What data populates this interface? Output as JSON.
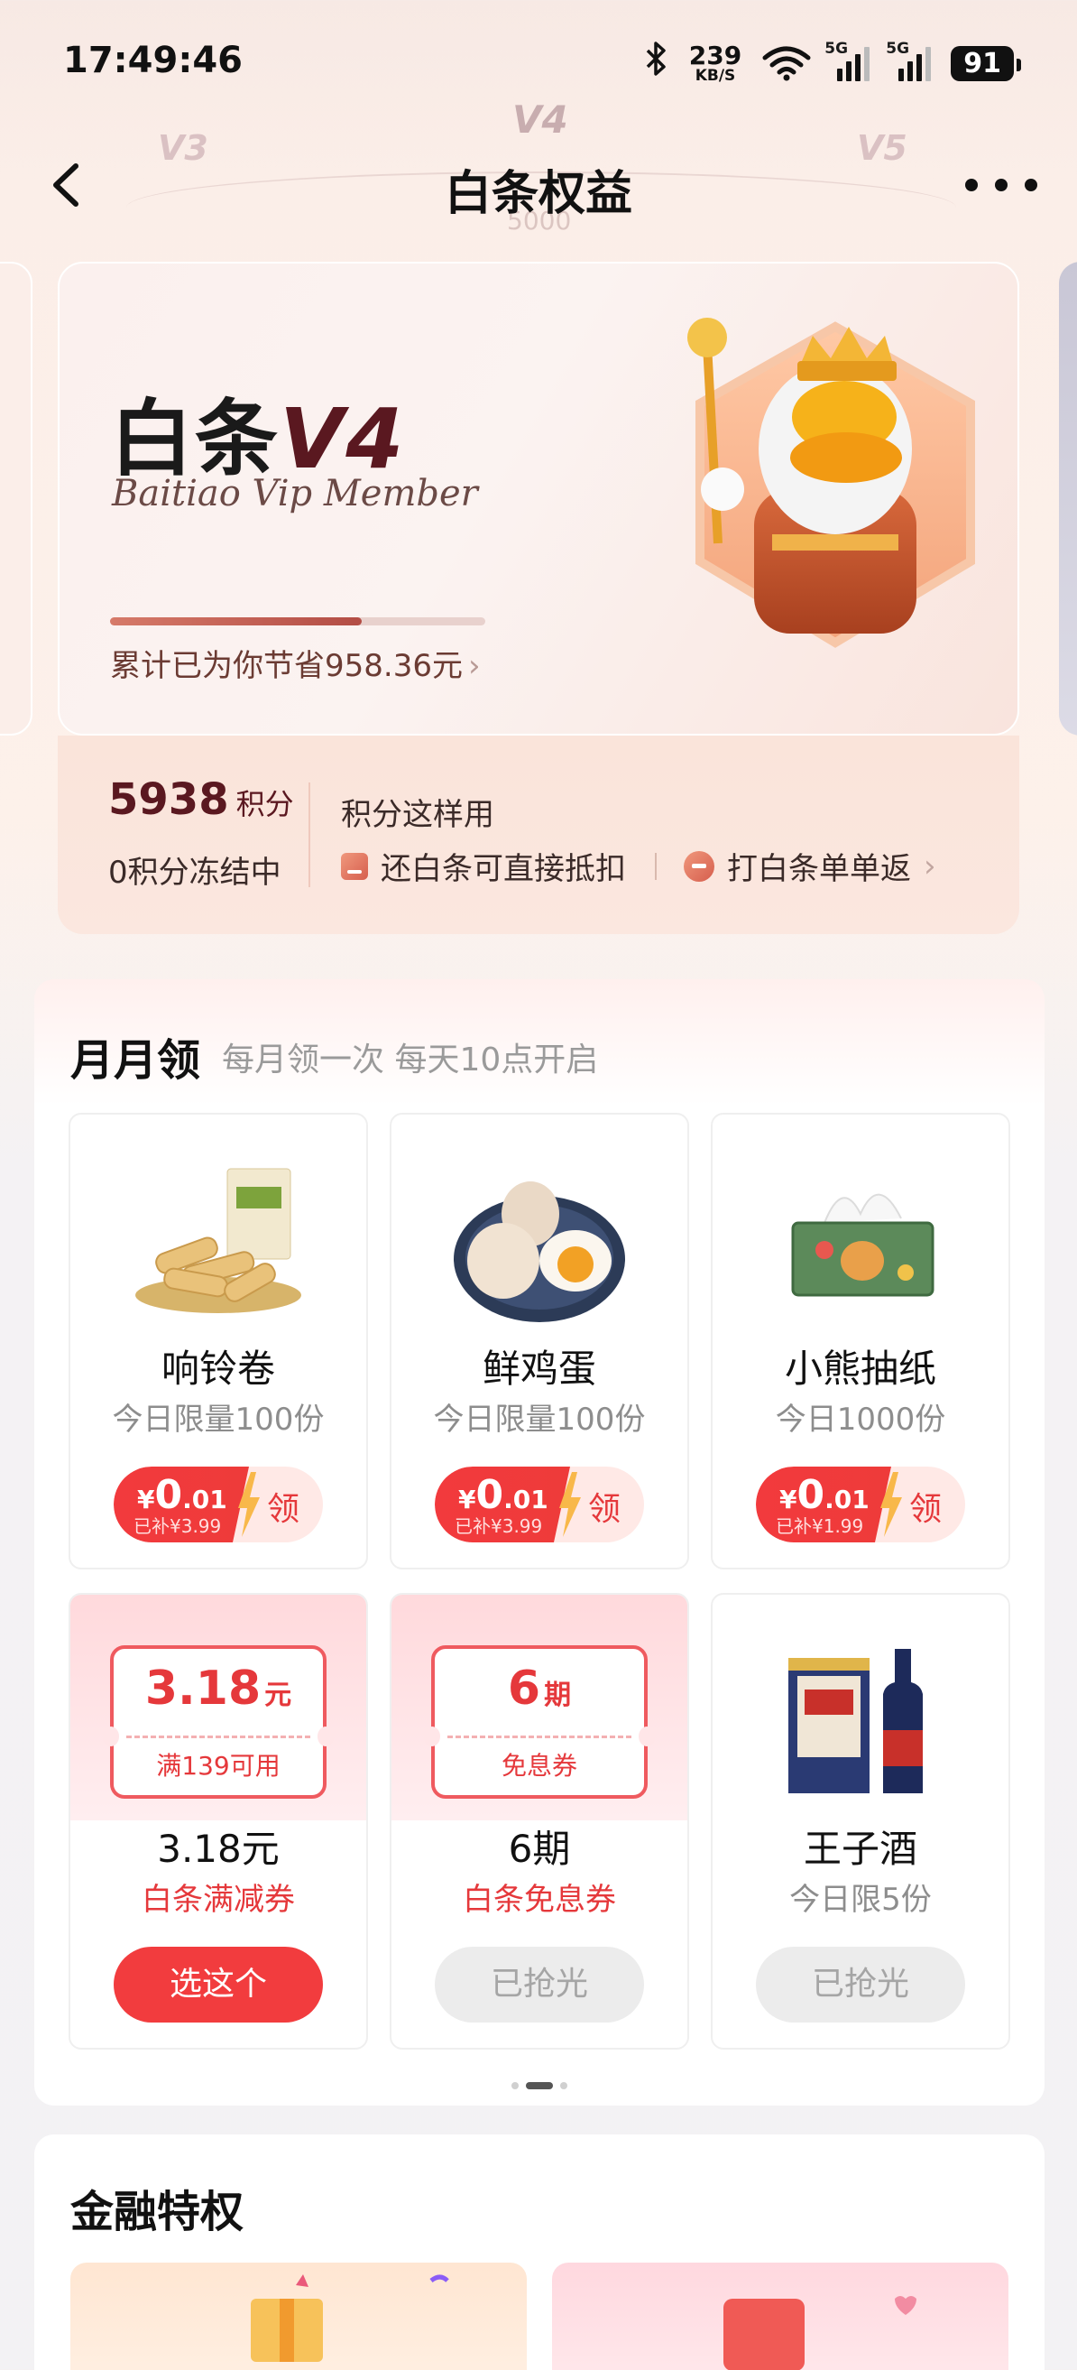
{
  "status_bar": {
    "time": "17:49:46",
    "speed_value": "239",
    "speed_unit": "KB/S",
    "signal1": "5G",
    "signal2": "5G",
    "battery": "91"
  },
  "nav": {
    "title": "白条权益",
    "level_left": "V3",
    "level_center": "V4",
    "level_right": "V5",
    "level_threshold": "5000"
  },
  "member_card": {
    "title_prefix": "白条",
    "title_level": "V4",
    "subtitle": "Baitiao Vip Member",
    "progress": 0.67,
    "saved_text": "累计已为你节省958.36元"
  },
  "points": {
    "value": "5938",
    "unit": "积分",
    "frozen": "0积分冻结中",
    "use_title": "积分这样用",
    "use1": "还白条可直接抵扣",
    "use2": "打白条单单返"
  },
  "monthly": {
    "title": "月月领",
    "subtitle": "每月领一次 每天10点开启",
    "items": [
      {
        "name": "响铃卷",
        "sub": "今日限量100份",
        "price_symbol": "¥",
        "price_int": "0",
        "price_dec": ".01",
        "subsidy": "已补¥3.99",
        "action": "领"
      },
      {
        "name": "鲜鸡蛋",
        "sub": "今日限量100份",
        "price_symbol": "¥",
        "price_int": "0",
        "price_dec": ".01",
        "subsidy": "已补¥3.99",
        "action": "领"
      },
      {
        "name": "小熊抽纸",
        "sub": "今日1000份",
        "price_symbol": "¥",
        "price_int": "0",
        "price_dec": ".01",
        "subsidy": "已补¥1.99",
        "action": "领"
      },
      {
        "name": "3.18元",
        "sub": "白条满减券",
        "coupon_value": "3.18",
        "coupon_unit": "元",
        "coupon_condition": "满139可用",
        "action": "选这个"
      },
      {
        "name": "6期",
        "sub": "白条免息券",
        "coupon_value": "6",
        "coupon_unit": "期",
        "coupon_condition": "免息券",
        "action": "已抢光"
      },
      {
        "name": "王子酒",
        "sub": "今日限5份",
        "action": "已抢光"
      }
    ]
  },
  "finance": {
    "title": "金融特权"
  },
  "colors": {
    "accent_red": "#f23c3e",
    "brand_dark": "#5a1820"
  }
}
